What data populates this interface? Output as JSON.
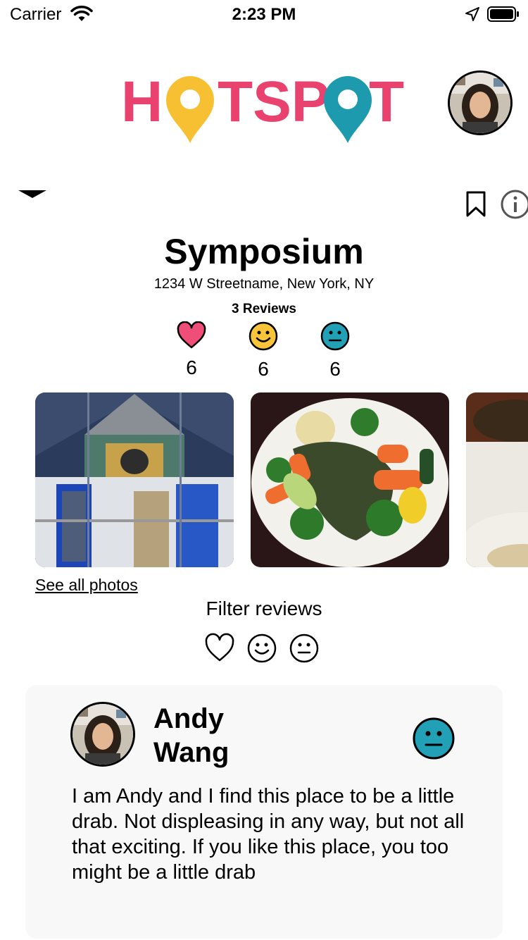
{
  "status_bar": {
    "carrier": "Carrier",
    "time": "2:23 PM"
  },
  "header": {
    "logo_text": "HOTSPOT"
  },
  "place": {
    "name": "Symposium",
    "address": "1234 W Streetname, New York, NY",
    "reviews_count": "3 Reviews",
    "stats": [
      {
        "icon": "heart-icon",
        "count": "6"
      },
      {
        "icon": "smile-icon",
        "count": "6"
      },
      {
        "icon": "neutral-face-icon",
        "count": "6"
      }
    ]
  },
  "photos": {
    "see_all_label": "See all photos"
  },
  "filter": {
    "title": "Filter reviews"
  },
  "review": {
    "author": "Andy Wang",
    "rating_icon": "neutral-face-icon",
    "text": "I am Andy and I find this place to be a little drab. Not displeasing in any way, but not all that exciting. If you like this place, you too might be a little drab"
  },
  "colors": {
    "logo_pink": "#e9426e",
    "logo_yellow": "#f7c033",
    "logo_teal": "#1e9aaf",
    "heart": "#ee4e78",
    "smile": "#f7c43a",
    "neutral": "#22a0b5"
  }
}
